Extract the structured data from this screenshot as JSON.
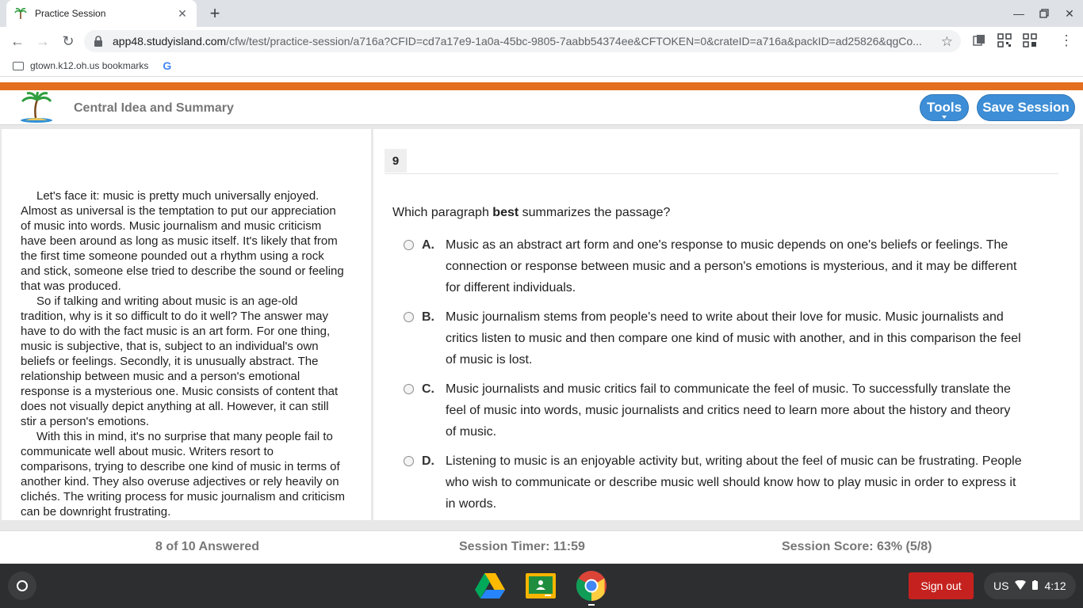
{
  "browser": {
    "tab_title": "Practice Session",
    "url_host": "app48.studyisland.com",
    "url_path": "/cfw/test/practice-session/a716a?CFID=cd7a17e9-1a0a-45bc-9805-7aabb54374ee&CFTOKEN=0&crateID=a716a&packID=ad25826&qgCo...",
    "bookmark_folder": "gtown.k12.oh.us bookmarks",
    "bookmark_google": "G"
  },
  "header": {
    "title": "Central Idea and Summary",
    "tools_label": "Tools",
    "save_label": "Save Session"
  },
  "passage": {
    "paragraphs": [
      "Let's face it: music is pretty much universally enjoyed. Almost as universal is the temptation to put our appreciation of music into words. Music journalism and music criticism have been around as long as music itself. It's likely that from the first time someone pounded out a rhythm using a rock and stick, someone else tried to describe the sound or feeling that was produced.",
      "So if talking and writing about music is an age-old tradition, why is it so difficult to do it well? The answer may have to do with the fact music is an art form. For one thing, music is subjective, that is, subject to an individual's own beliefs or feelings. Secondly, it is unusually abstract. The relationship between music and a person's emotional response is a mysterious one. Music consists of content that does not visually depict anything at all. However, it can still stir a person's emotions.",
      "With this in mind, it's no surprise that many people fail to communicate well about music. Writers resort to comparisons, trying to describe one kind of music in terms of another kind. They also overuse adjectives or rely heavily on clichés. The writing process for music journalism and criticism can be downright frustrating."
    ]
  },
  "question": {
    "number": "9",
    "prompt_pre": "Which paragraph ",
    "prompt_bold": "best",
    "prompt_post": " summarizes the passage?",
    "options": [
      {
        "letter": "A.",
        "text": "Music as an abstract art form and one's response to music depends on one's beliefs or feelings. The connection or response between music and a person's emotions is mysterious, and it may be different for different individuals."
      },
      {
        "letter": "B.",
        "text": "Music journalism stems from people's need to write about their love for music. Music journalists and critics listen to music and then compare one kind of music with another, and in this comparison the feel of music is lost."
      },
      {
        "letter": "C.",
        "text": "Music journalists and music critics fail to communicate the feel of music. To successfully translate the feel of music into words, music journalists and critics need to learn more about the history and theory of music."
      },
      {
        "letter": "D.",
        "text": "Listening to music is an enjoyable activity but, writing about the feel of music can be frustrating. People who wish to communicate or describe music well should know how to play music in order to express it in words."
      }
    ]
  },
  "status": {
    "answered": "8 of 10 Answered",
    "timer": "Session Timer: 11:59",
    "score": "Session Score: 63% (5/8)"
  },
  "shelf": {
    "signout_label": "Sign out",
    "locale": "US",
    "time": "4:12"
  },
  "colors": {
    "accent_orange": "#e46e1f",
    "button_blue": "#3d8ed6",
    "signout_red": "#c5221f"
  }
}
